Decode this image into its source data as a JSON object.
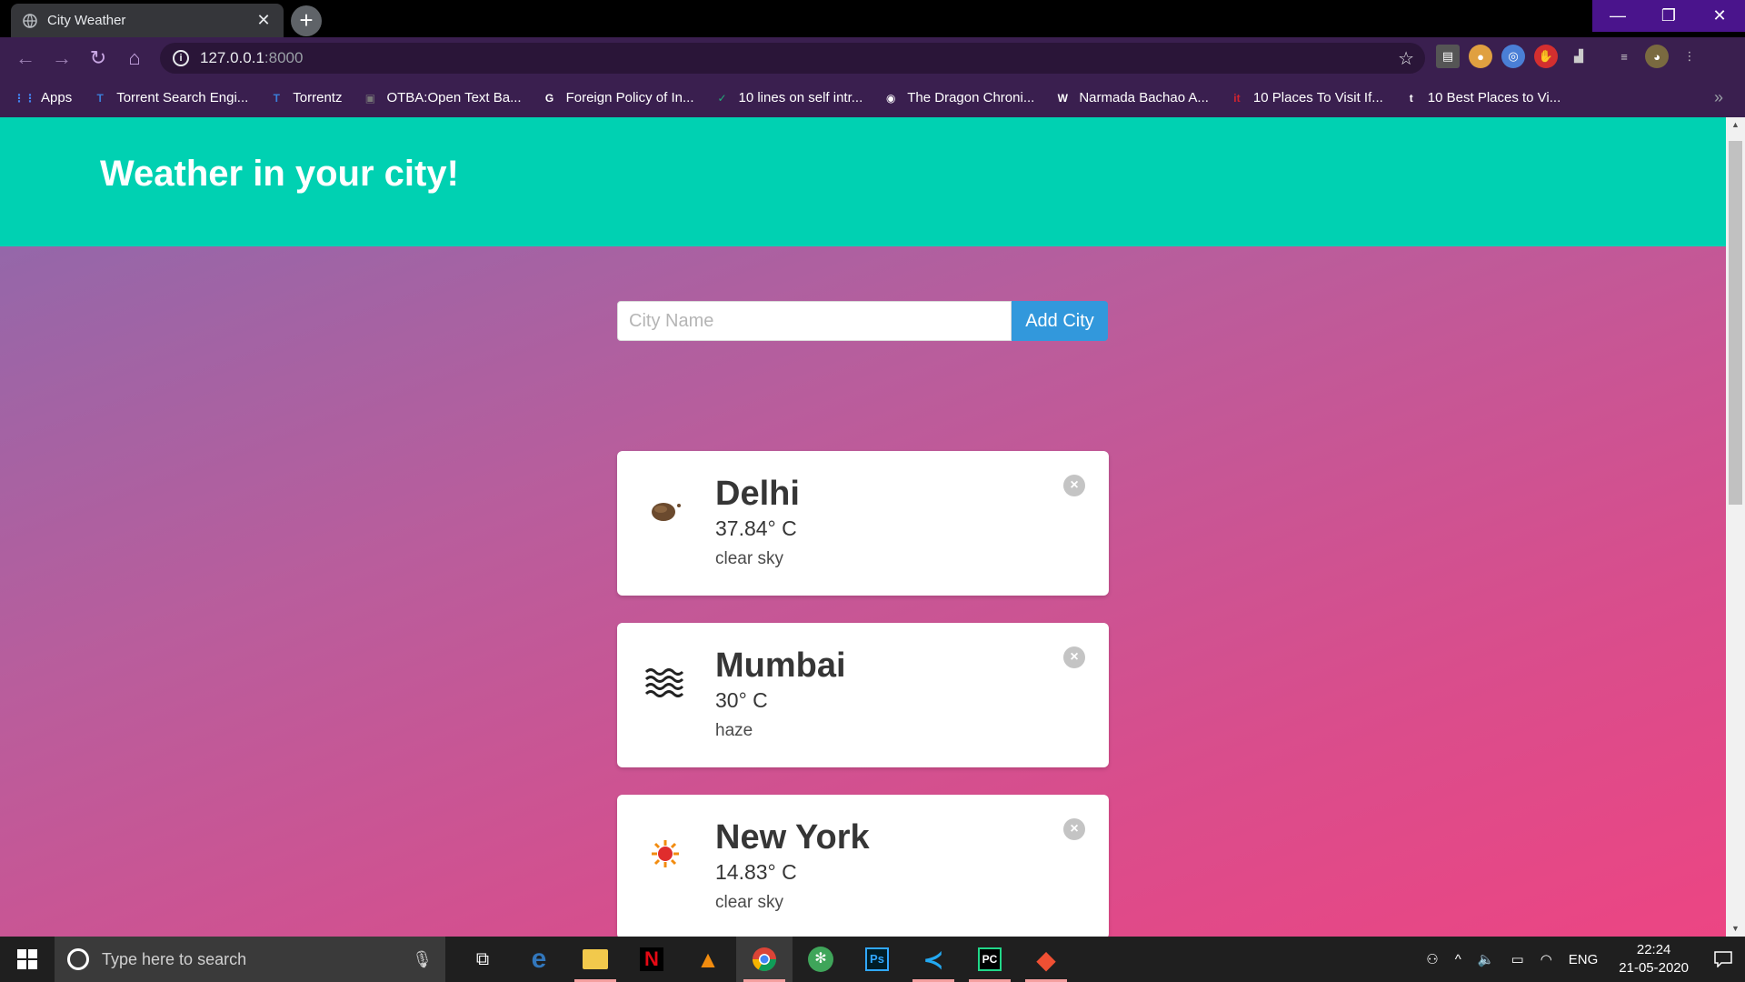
{
  "browser": {
    "tab_title": "City Weather",
    "url_host": "127.0.0.1",
    "url_port": ":8000",
    "bookmarks": [
      {
        "label": "Apps",
        "color": "#4285f4",
        "glyph": "⋮⋮"
      },
      {
        "label": "Torrent Search Engi...",
        "color": "#3b7dd8",
        "glyph": "T"
      },
      {
        "label": "Torrentz",
        "color": "#3b7dd8",
        "glyph": "T"
      },
      {
        "label": "OTBA:Open Text Ba...",
        "color": "#777777",
        "glyph": "▣"
      },
      {
        "label": "Foreign Policy of In...",
        "color": "#ffffff",
        "glyph": "G"
      },
      {
        "label": "10 lines on self intr...",
        "color": "#20b27a",
        "glyph": "✓"
      },
      {
        "label": "The Dragon Chroni...",
        "color": "#ffffff",
        "glyph": "◉"
      },
      {
        "label": "Narmada Bachao A...",
        "color": "#ffffff",
        "glyph": "W"
      },
      {
        "label": "10 Places To Visit If...",
        "color": "#d3232f",
        "glyph": "it"
      },
      {
        "label": "10 Best Places to Vi...",
        "color": "#ffffff",
        "glyph": "t"
      }
    ]
  },
  "page": {
    "hero_title": "Weather in your city!",
    "form": {
      "input_placeholder": "City Name",
      "input_value": "",
      "add_button": "Add City"
    },
    "cities": [
      {
        "name": "Delhi",
        "temp": "37.84° C",
        "description": "clear sky",
        "icon": "moon-icon"
      },
      {
        "name": "Mumbai",
        "temp": "30° C",
        "description": "haze",
        "icon": "haze-icon"
      },
      {
        "name": "New York",
        "temp": "14.83° C",
        "description": "clear sky",
        "icon": "sun-icon"
      }
    ],
    "colors": {
      "hero": "#00d1b2",
      "button": "#3298dc"
    }
  },
  "taskbar": {
    "search_placeholder": "Type here to search",
    "language": "ENG",
    "time": "22:24",
    "date": "21-05-2020"
  }
}
